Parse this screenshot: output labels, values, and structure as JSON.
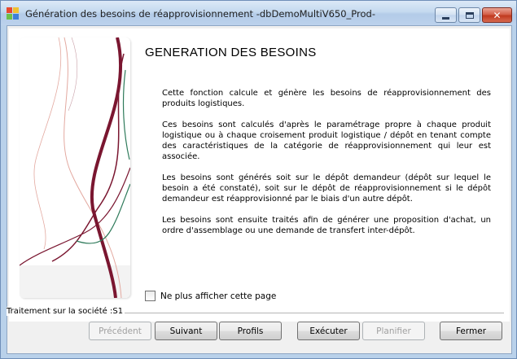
{
  "window": {
    "title": "Génération des besoins de réapprovisionnement -dbDemoMultiV650_Prod-",
    "controls": {
      "minimize": "minimize",
      "maximize": "maximize",
      "close": "✕"
    }
  },
  "page": {
    "heading": "GENERATION DES BESOINS",
    "paragraphs": [
      "Cette fonction calcule et génère les besoins de réapprovisionnement des produits logistiques.",
      "Ces besoins sont calculés d'après le paramétrage propre à chaque produit logistique ou à chaque croisement produit logistique / dépôt en tenant compte des caractéristiques de la catégorie de réapprovisionnement qui leur est associée.",
      "Les besoins sont générés soit sur le dépôt demandeur (dépôt sur lequel le besoin a été constaté), soit sur le dépôt de réapprovisionnement si le dépôt demandeur est réapprovisionné par le biais d'un autre dépôt.",
      "Les besoins sont ensuite traités afin de générer une proposition d'achat, un ordre d'assemblage ou une demande de transfert inter-dépôt."
    ],
    "checkbox": {
      "label": "Ne plus afficher cette page",
      "checked": false
    },
    "company": "Traitement sur la société :S1"
  },
  "buttons": {
    "previous": {
      "label": "Précédent",
      "enabled": false
    },
    "next": {
      "label": "Suivant",
      "enabled": true
    },
    "profiles": {
      "label": "Profils",
      "enabled": true
    },
    "execute": {
      "label": "Exécuter",
      "enabled": true
    },
    "plan": {
      "label": "Planifier",
      "enabled": false
    },
    "close": {
      "label": "Fermer",
      "enabled": true
    }
  },
  "colors": {
    "titlebar": "#c4d9ef",
    "close_button": "#c0391f",
    "art_curve_dark": "#7a1630",
    "art_curve_green": "#2e7a5a",
    "art_curve_light": "#e3a9a0"
  }
}
